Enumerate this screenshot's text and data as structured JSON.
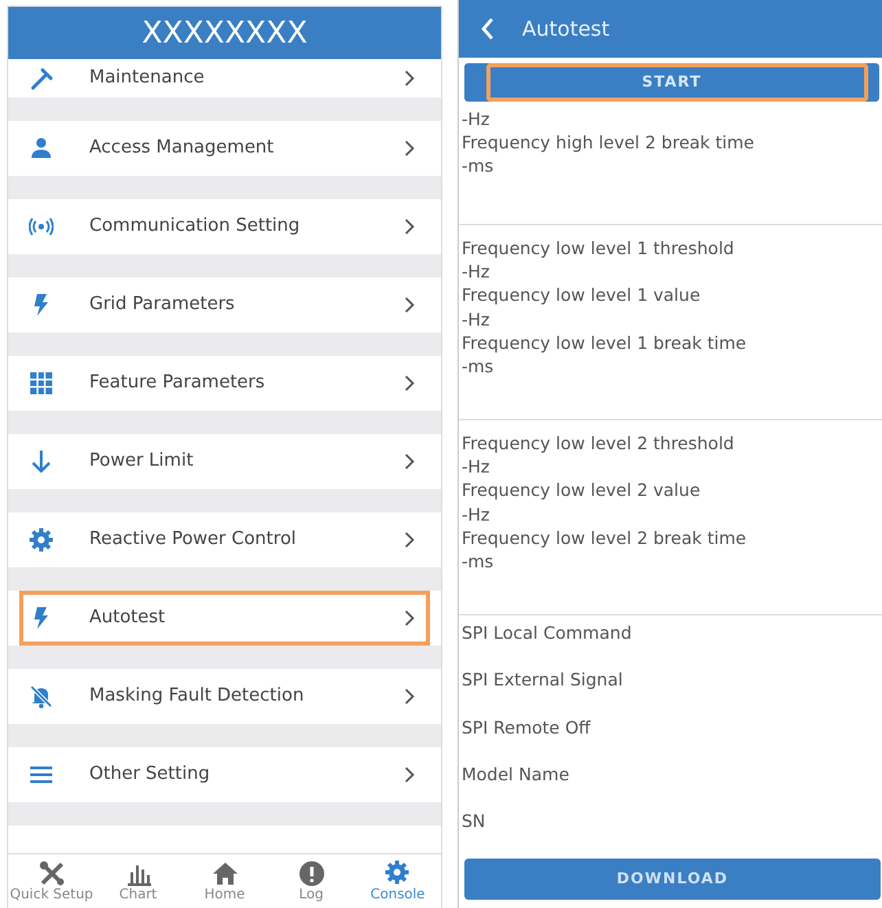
{
  "console_screen": {
    "title": "XXXXXXXX",
    "menu_items": [
      {
        "kind": "wrench",
        "label": "Maintenance",
        "highlighted": false
      },
      {
        "kind": "person",
        "label": "Access Management",
        "highlighted": false
      },
      {
        "kind": "signal",
        "label": "Communication Setting",
        "highlighted": false
      },
      {
        "kind": "bolt",
        "label": "Grid Parameters",
        "highlighted": false
      },
      {
        "kind": "grid",
        "label": "Feature Parameters",
        "highlighted": false
      },
      {
        "kind": "arrow",
        "label": "Power Limit",
        "highlighted": false
      },
      {
        "kind": "gear",
        "label": "Reactive Power Control",
        "highlighted": false
      },
      {
        "kind": "bolt",
        "label": "Autotest",
        "highlighted": true
      },
      {
        "kind": "bell",
        "label": "Masking Fault Detection",
        "highlighted": false
      },
      {
        "kind": "lines",
        "label": "Other Setting",
        "highlighted": false
      }
    ],
    "tab_bar": [
      {
        "kind": "tools",
        "label": "Quick Setup",
        "selected": false
      },
      {
        "kind": "chart",
        "label": "Chart",
        "selected": false
      },
      {
        "kind": "home",
        "label": "Home",
        "selected": false
      },
      {
        "kind": "info",
        "label": "Log",
        "selected": false
      },
      {
        "kind": "gear",
        "label": "Console",
        "selected": true
      }
    ]
  },
  "autotest_screen": {
    "title": "Autotest",
    "start_button": {
      "label": "START",
      "highlighted": true
    },
    "groups": [
      {
        "lines": [
          "-Hz",
          "Frequency high level 2 break time",
          "-ms"
        ]
      },
      {
        "lines": [
          "Frequency low level 1 threshold",
          "-Hz",
          "Frequency low level 1 value",
          "-Hz",
          "Frequency low level 1 break time",
          "-ms"
        ]
      },
      {
        "lines": [
          "Frequency low level 2 threshold",
          "-Hz",
          "Frequency low level 2 value",
          "-Hz",
          "Frequency low level 2 break time",
          "-ms"
        ]
      }
    ],
    "info_rows": [
      "SPI Local Command",
      "SPI External Signal",
      "SPI Remote Off",
      "Model Name",
      "SN"
    ],
    "download_button": "DOWNLOAD"
  }
}
